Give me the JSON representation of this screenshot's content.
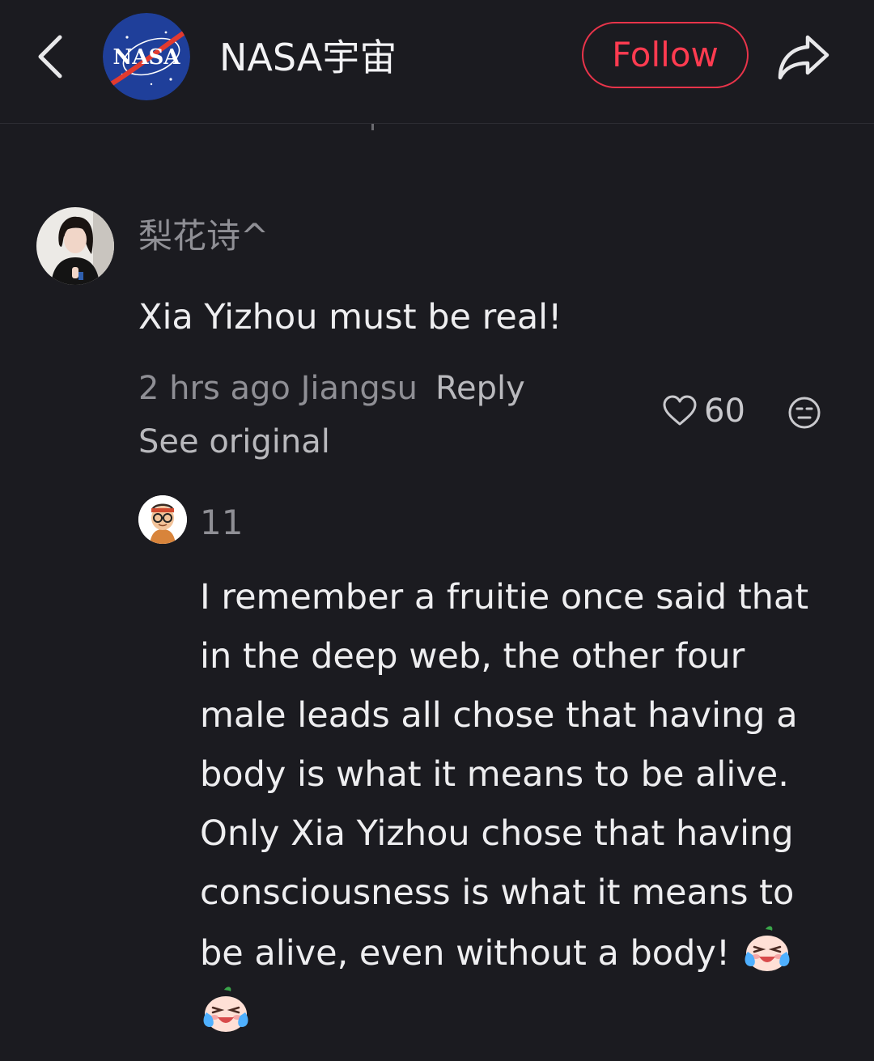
{
  "header": {
    "account_name": "NASA宇宙",
    "follow_label": "Follow",
    "logo_text": "NASA"
  },
  "comment": {
    "username": "梨花诗^",
    "text": "Xia Yizhou must be real!",
    "time_location": "2 hrs ago Jiangsu",
    "reply_label": "Reply",
    "see_original_label": "See original",
    "like_count": "60"
  },
  "reply": {
    "username": "11",
    "lines": [
      "I remember a fruitie once said that",
      "in the deep web, the other four",
      "male leads all chose that having a",
      "body is what it means to be alive.",
      "Only Xia Yizhou chose that having",
      "consciousness is what it means to",
      "be alive, even without a body!"
    ]
  },
  "colors": {
    "background": "#1b1b20",
    "follow_accent": "#ff3b50",
    "muted_text": "#8f8f95"
  },
  "icons": [
    "back-arrow-icon",
    "nasa-logo",
    "share-icon",
    "heart-icon",
    "emoji-face-icon",
    "crying-emoji-icon"
  ]
}
